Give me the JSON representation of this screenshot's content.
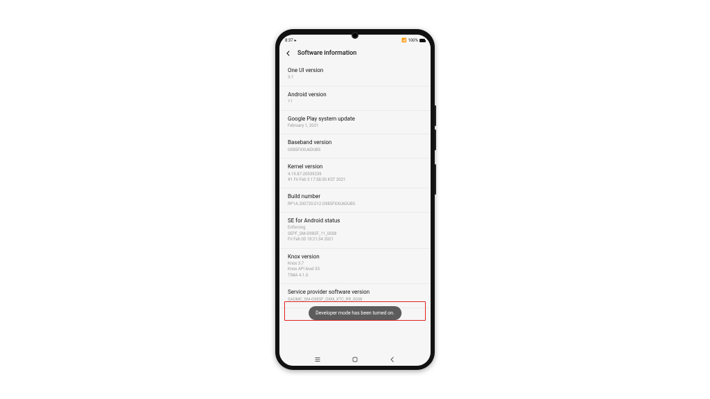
{
  "statusbar": {
    "time": "8:37",
    "battery_text": "100%"
  },
  "header": {
    "title": "Software information"
  },
  "items": [
    {
      "label": "One UI version",
      "value": "3.1"
    },
    {
      "label": "Android version",
      "value": "11"
    },
    {
      "label": "Google Play system update",
      "value": "February 1, 2021"
    },
    {
      "label": "Baseband version",
      "value": "G985FXXU6DUB5"
    },
    {
      "label": "Kernel version",
      "value": "4.19.87-20939239\n#1 Fri Feb 5 17:58:30 KST 2021"
    },
    {
      "label": "Build number",
      "value": "RP1A.200720.012.G985FXXU6DUB5"
    },
    {
      "label": "SE for Android status",
      "value": "Enforcing\nSEPF_SM-G985F_11_0008\nFri Feb 05 18:21:34 2021"
    },
    {
      "label": "Knox version",
      "value": "Knox 3.7\nKnox API level 33\nTIMA 4.1.0"
    },
    {
      "label": "Service provider software version",
      "value": "SAOMC_SM-G985F_OXM_XTC_RR_0008"
    }
  ],
  "toast": {
    "text": "Developer mode has been turned on."
  }
}
